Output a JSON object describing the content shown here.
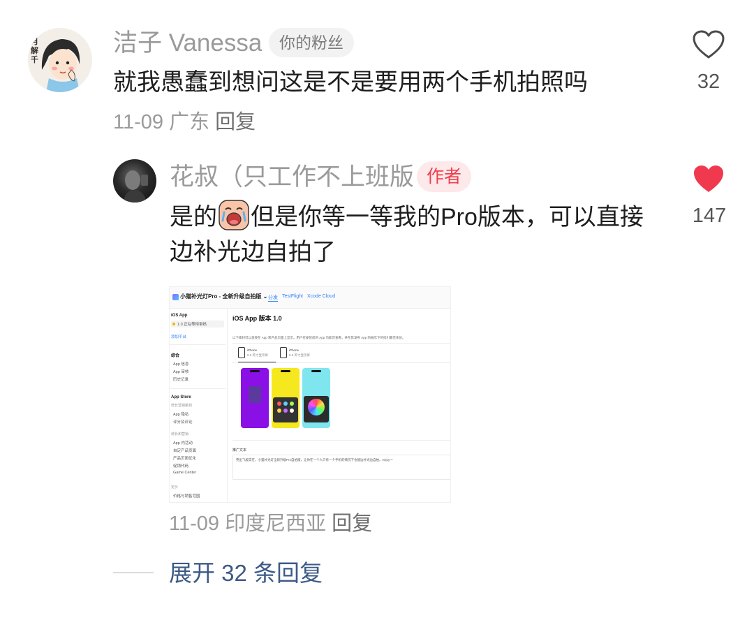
{
  "comment": {
    "avatar_text": "月解千",
    "username": "洁子 Vanessa",
    "badge": "你的粉丝",
    "text": "就我愚蠢到想问这是不是要用两个手机拍照吗",
    "date": "11-09",
    "location": "广东",
    "reply_label": "回复",
    "like_count": "32",
    "liked": false
  },
  "reply": {
    "username": "花叔（只工作不上班版",
    "badge": "作者",
    "text_part1": "是的",
    "emoji": "crying-face",
    "text_part2": "但是你等一等我的Pro版本，可以直接",
    "text_line2": "边补光边自拍了",
    "date": "11-09",
    "location": "印度尼西亚",
    "reply_label": "回复",
    "like_count": "147",
    "liked": true,
    "like_color": "#f0394e"
  },
  "attachment": {
    "app_title": "小猫补光灯Pro - 全新升级自拍版 ⌄",
    "tabs": [
      "分发",
      "TestFlight",
      "Xcode Cloud"
    ],
    "sidebar": {
      "section_ios": "iOS App",
      "version": "1.0 正在等待审核",
      "add_platform": "添加平台",
      "section_general": "综合",
      "general_items": [
        "App 信息",
        "App 审核",
        "历史记录"
      ],
      "section_store": "App Store",
      "store_sub": "增长营销策划",
      "store_items": [
        "App 隐私",
        "评分及评论"
      ],
      "features_sub": "增长和营销",
      "features_items": [
        "App 内活动",
        "自定产品页面",
        "产品页面优化",
        "促销代码",
        "Game Center"
      ],
      "pricing_sub": "定价",
      "pricing_items": [
        "价格与销售范围"
      ]
    },
    "main_title": "iOS App 版本 1.0",
    "description": "以下素材可以直接在 App 和产品页面上显示。用户在安装前的 App 功能可查看，并在其发布 App 的展示下的指引最佳体验。",
    "devices": [
      {
        "name": "iPhone",
        "size": "6.9 英寸显示屏"
      },
      {
        "name": "iPhone",
        "size": "6.5 英寸显示屏"
      }
    ],
    "phone_colors": [
      "#8a10e6",
      "#f5e81e",
      "#7fe6f0"
    ],
    "promo_label": "推广文本",
    "promo_text": "突出飞般实在，小猫补光灯全新升级Pro自拍版，让你在一个人只有一个手机的情况下也能边补光边自拍。enjoy～"
  },
  "footer": {
    "expand_label": "展开 32 条回复"
  }
}
